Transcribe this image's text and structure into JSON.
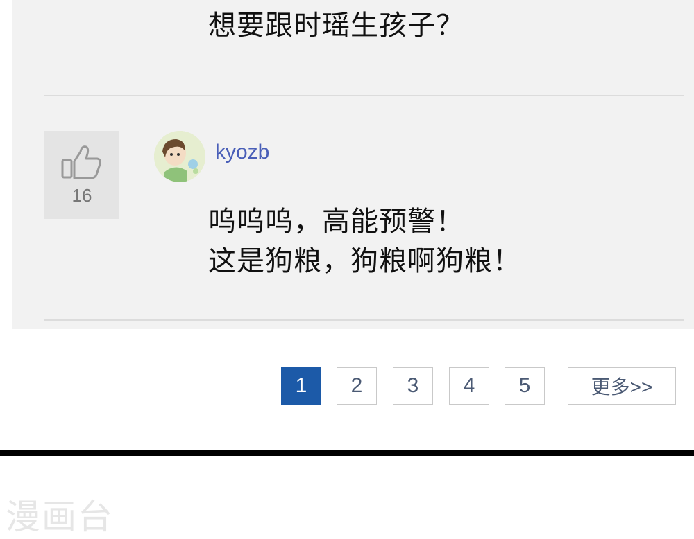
{
  "previous_comment": {
    "text": "想要跟时瑶生孩子？"
  },
  "comment": {
    "like_icon": "thumbs-up-icon",
    "like_count": "16",
    "avatar_icon": "user-avatar",
    "username": "kyozb",
    "lines": [
      "呜呜呜，高能预警！",
      "这是狗粮，狗粮啊狗粮！"
    ]
  },
  "pagination": {
    "pages": [
      "1",
      "2",
      "3",
      "4",
      "5"
    ],
    "active_page": "1",
    "more_label": "更多>>",
    "active_color": "#1c5aa8"
  },
  "watermark": {
    "text": "漫画台"
  }
}
